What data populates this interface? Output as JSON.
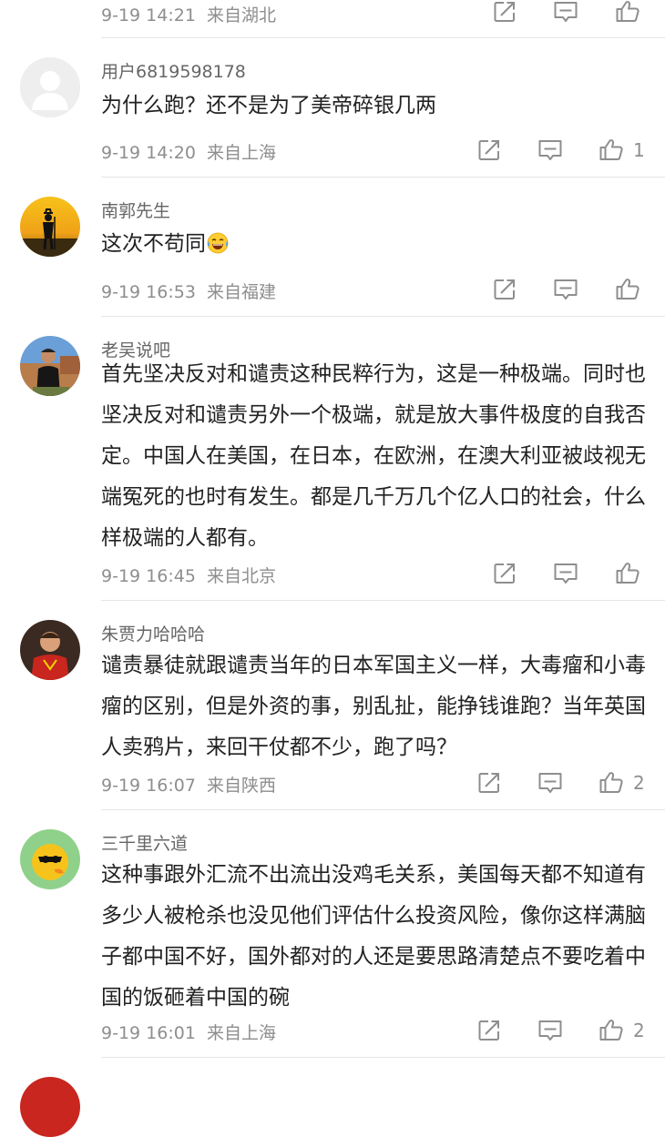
{
  "colors": {
    "text": "#222222",
    "meta": "#8e8e8e",
    "divider": "#e6e6e6",
    "icon": "#8e8e8e"
  },
  "icons": {
    "share": "share-icon",
    "comment": "comment-icon",
    "like": "thumbs-up-icon"
  },
  "comments": [
    {
      "time": "9-19 14:21",
      "location": "来自湖北",
      "likes": ""
    },
    {
      "username": "用户6819598178",
      "text": "为什么跑？还不是为了美帝碎银几两",
      "time": "9-19 14:20",
      "location": "来自上海",
      "likes": "1"
    },
    {
      "username": "南郭先生",
      "text": "这次不苟同",
      "emoji": "laughing-tears-emoji",
      "time": "9-19 16:53",
      "location": "来自福建",
      "likes": ""
    },
    {
      "username": "老吴说吧",
      "text": "首先坚决反对和谴责这种民粹行为，这是一种极端。同时也坚决反对和谴责另外一个极端，就是放大事件极度的自我否定。中国人在美国，在日本，在欧洲，在澳大利亚被歧视无端冤死的也时有发生。都是几千万几个亿人口的社会，什么样极端的人都有。",
      "time": "9-19 16:45",
      "location": "来自北京",
      "likes": ""
    },
    {
      "username": "朱贾力哈哈哈",
      "text": "谴责暴徒就跟谴责当年的日本军国主义一样，大毒瘤和小毒瘤的区别，但是外资的事，别乱扯，能挣钱谁跑？当年英国人卖鸦片，来回干仗都不少，跑了吗？",
      "time": "9-19 16:07",
      "location": "来自陕西",
      "likes": "2"
    },
    {
      "username": "三千里六道",
      "text": "这种事跟外汇流不出流出没鸡毛关系，美国每天都不知道有多少人被枪杀也没见他们评估什么投资风险，像你这样满脑子都中国不好，国外都对的人还是要思路清楚点不要吃着中国的饭砸着中国的碗",
      "time": "9-19 16:01",
      "location": "来自上海",
      "likes": "2"
    }
  ]
}
